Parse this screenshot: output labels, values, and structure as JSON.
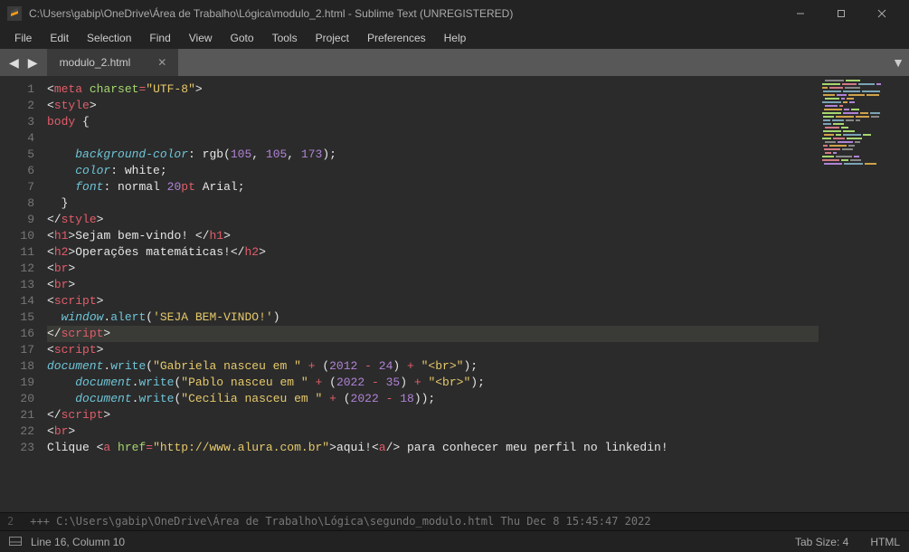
{
  "window": {
    "title": "C:\\Users\\gabip\\OneDrive\\Área de Trabalho\\Lógica\\modulo_2.html - Sublime Text (UNREGISTERED)"
  },
  "menu": {
    "items": [
      "File",
      "Edit",
      "Selection",
      "Find",
      "View",
      "Goto",
      "Tools",
      "Project",
      "Preferences",
      "Help"
    ]
  },
  "tab": {
    "name": "modulo_2.html"
  },
  "code": {
    "line_count": 23,
    "highlighted_line": 16
  },
  "tokens": {
    "meta": "meta",
    "charset": "charset",
    "utf8": "\"UTF-8\"",
    "style": "style",
    "body_sel": "body",
    "open_brace": "{",
    "close_brace": "}",
    "bg_prop": "background-color",
    "bg_val": "rgb",
    "bg_r": "105",
    "bg_g": "105",
    "bg_b": "173",
    "color_prop": "color",
    "color_val": "white",
    "font_prop": "font",
    "font_normal": "normal",
    "font_size": "20",
    "font_unit": "pt",
    "font_face": "Arial",
    "h1": "h1",
    "h1_text": "Sejam bem-vindo! ",
    "h2": "h2",
    "h2_text": "Operações matemáticas!",
    "br": "br",
    "script": "script",
    "window_obj": "window",
    "alert": "alert",
    "alert_msg": "'SEJA BEM-VINDO!'",
    "document": "document",
    "write": "write",
    "gabriela": "\"Gabriela nasceu em \"",
    "pablo": "\"Pablo nasceu em \"",
    "cecilia": "\"Cecília nasceu em \"",
    "brk": "\"<br>\"",
    "n2012": "2012",
    "n24": "24",
    "n2022": "2022",
    "n35": "35",
    "n2022b": "2022",
    "n18": "18",
    "clique": "Clique ",
    "a": "a",
    "href": "href",
    "url": "\"http://www.alura.com.br\"",
    "aqui": "aqui!",
    "trail": " para conhecer meu perfil no linkedin!"
  },
  "console": {
    "line1_prefix": "2",
    "line1": "+++ C:\\Users\\gabip\\OneDrive\\Área de Trabalho\\Lógica\\segundo_modulo.html Thu Dec  8 15:45:47 2022"
  },
  "status": {
    "cursor": "Line 16, Column 10",
    "indent": "Tab Size: 4",
    "syntax": "HTML"
  }
}
